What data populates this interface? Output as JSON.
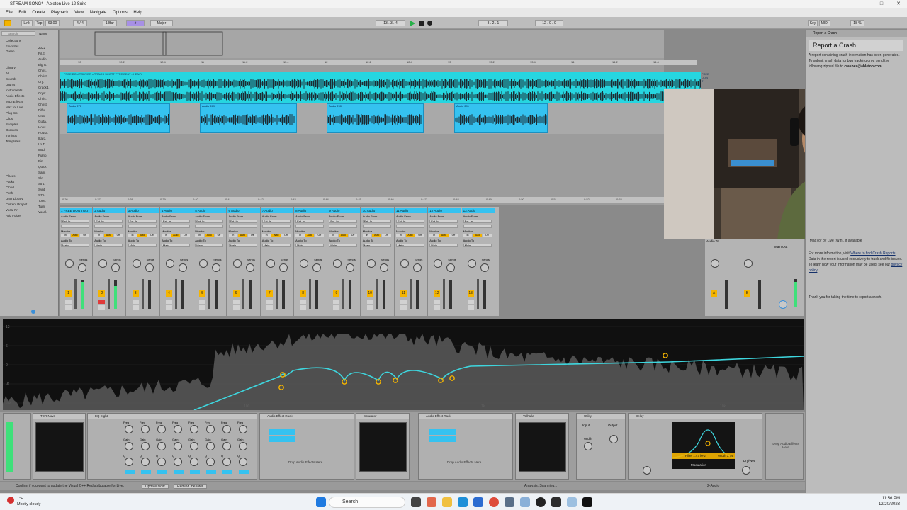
{
  "window": {
    "title": "STREAM SONG* - Ableton Live 12 Suite",
    "controls": [
      "–",
      "□",
      "✕"
    ]
  },
  "menu": [
    "File",
    "Edit",
    "Create",
    "Playback",
    "View",
    "Navigate",
    "Options",
    "Help"
  ],
  "transport": {
    "tap": "Tap",
    "tempo": "63.00",
    "signature": "4 / 4",
    "quantize": "1 Bar",
    "key": "Major",
    "position": "13 . 3 . 4",
    "loop_start": "8 . 2 . 1",
    "loop_length": "12 . 0 . 0",
    "key_label": "Key",
    "midi_label": "MIDI",
    "cpu": "18 %"
  },
  "browser": {
    "search_placeholder": "Search",
    "collections_title": "Collections",
    "collections": [
      "Favorites",
      "Green"
    ],
    "library_title": "Library",
    "library": [
      "All",
      "Sounds",
      "Drums",
      "Instruments",
      "Audio Effects",
      "MIDI Effects",
      "Max for Live",
      "Plug-Ins",
      "Clips",
      "Samples",
      "Grooves",
      "Tunings",
      "Templates"
    ],
    "places_title": "Places",
    "places": [
      "Packs",
      "Cloud",
      "Push",
      "User Library",
      "Current Project",
      "Vocal Pr",
      "Add Folder"
    ],
    "name_header": "Name",
    "files": [
      "2022",
      "Fil.E",
      "Audio",
      "Big G.",
      "Chris.",
      "Christi.",
      "Cry.",
      "Crackd.",
      "Cryst.",
      "Chris.",
      "Christ.",
      "Diffu.",
      "Grat.",
      "Guita.",
      "Hous.",
      "Housa.",
      "Ikard.",
      "Lo Ti.",
      "Mod.",
      "Piano.",
      "Pin.",
      "Quick.",
      "Sam.",
      "Slo.",
      "Stru.",
      "Synt.",
      "SZA.",
      "Tone.",
      "Turn.",
      "Vocal."
    ]
  },
  "arrangement": {
    "ruler_top": [
      "10",
      "10.2",
      "10.4",
      "11",
      "11.2",
      "11.4",
      "12",
      "12.2",
      "12.4",
      "13",
      "13.2",
      "13.4",
      "14",
      "14.2",
      "14.4"
    ],
    "main_clip_label": "FREE DON TOLIVER x TRAVIS SCOTT TYPE BEAT - HEAVY",
    "main_clip_label_right": "FREE DON T",
    "vocal_clips": [
      "Audio 271",
      "Audio 289",
      "Audio 290",
      "Audio 291"
    ],
    "ruler_bottom": [
      "0:36",
      "0:37",
      "0:38",
      "0:39",
      "0:40",
      "0:41",
      "0:42",
      "0:43",
      "0:44",
      "0:45",
      "0:46",
      "0:47",
      "0:48",
      "0:49",
      "0:50",
      "0:51",
      "0:52",
      "0:53"
    ]
  },
  "mixer": {
    "channels": [
      {
        "name": "1 FREE DON TOLI",
        "num": "1",
        "level": 0.95
      },
      {
        "name": "2 Audio",
        "num": "2",
        "level": 0.8
      },
      {
        "name": "3 Audio",
        "num": "3",
        "level": 0
      },
      {
        "name": "4 Audio",
        "num": "4",
        "level": 0
      },
      {
        "name": "5 Audio",
        "num": "5",
        "level": 0
      },
      {
        "name": "6 Audio",
        "num": "6",
        "level": 0
      },
      {
        "name": "7 Audio",
        "num": "7",
        "level": 0
      },
      {
        "name": "8 Audio",
        "num": "8",
        "level": 0
      },
      {
        "name": "9 Audio",
        "num": "9",
        "level": 0
      },
      {
        "name": "10 Audio",
        "num": "10",
        "level": 0
      },
      {
        "name": "11 Audio",
        "num": "11",
        "level": 0
      },
      {
        "name": "12 Audio",
        "num": "12",
        "level": 0
      },
      {
        "name": "13 Audio",
        "num": "13",
        "level": 0
      }
    ],
    "audio_from": "Audio From",
    "ext_in": "Ext. In",
    "monitor": "Monitor",
    "monitor_opts": [
      "In",
      "Auto",
      "Off"
    ],
    "audio_to": "Audio To",
    "main": "Main",
    "sends": "Sends",
    "returns": [
      {
        "num": "A"
      },
      {
        "num": "B"
      }
    ],
    "main_label": "Main Out"
  },
  "crash": {
    "header": "Report a Crash",
    "title": "Report a Crash",
    "para1": "A report containing crash information has been generated. To submit crash data for bug tracking only, send the following zipped file to",
    "email": "crashes@ableton.com",
    "para2_pre": "(Mac) or by Live (Win), if available",
    "para3": "For more information, visit",
    "link1": "Where to find Crash Reports",
    "para3b": ". Data in the report is used exclusively to track and fix issues. To learn how your information may be used, see our",
    "link2": "privacy policy",
    "para4": "Thank you for taking the time to report a crash."
  },
  "eq": {
    "db_labels": [
      "12",
      "6",
      "0",
      "-6",
      "-12"
    ],
    "freq_labels": [
      "100",
      "1k",
      "10k"
    ],
    "curve_color": "#3ed6de",
    "point_color": "#f4b400"
  },
  "devices": {
    "dev1": "TDR Nova",
    "dev2": "EQ Eight",
    "dev3": "Audio Effect Rack",
    "dev4": "Saturator",
    "dev5": "Audio Effect Rack",
    "dev6": "Valhalla",
    "dev7": "Utility",
    "dev8": "Delay",
    "drop_text": "Drop Audio Effects Here",
    "freq": "Freq",
    "gain": "Gain",
    "q": "Q",
    "input": "Input",
    "output": "Output",
    "width": "Width",
    "filter": "Filter",
    "filter_vals": "1.47 kHz",
    "width_val": "3.74",
    "mod_label": "Modulation",
    "rate": "Rate",
    "rate_val": "0.50 Hz",
    "filter_mod": "Filter",
    "filter_mod_val": "50 %",
    "time": "Time",
    "time_val": "0.0 %",
    "feedback": "Feedback",
    "dry_wet": "Dry/Wet",
    "right_drop": "Drop Audio Effects Here"
  },
  "status": {
    "message": "Confirm if you want to update the Visual C++ Redistributable for Live.",
    "btn_update": "Update Now",
    "btn_later": "Remind me later",
    "analysis": "Analysis: Scanning...",
    "track": "2-Audio"
  },
  "taskbar": {
    "weather_temp": "1°F",
    "weather_desc": "Mostly cloudy",
    "search": "Search",
    "time": "11:56 PM",
    "date": "12/20/2023"
  }
}
